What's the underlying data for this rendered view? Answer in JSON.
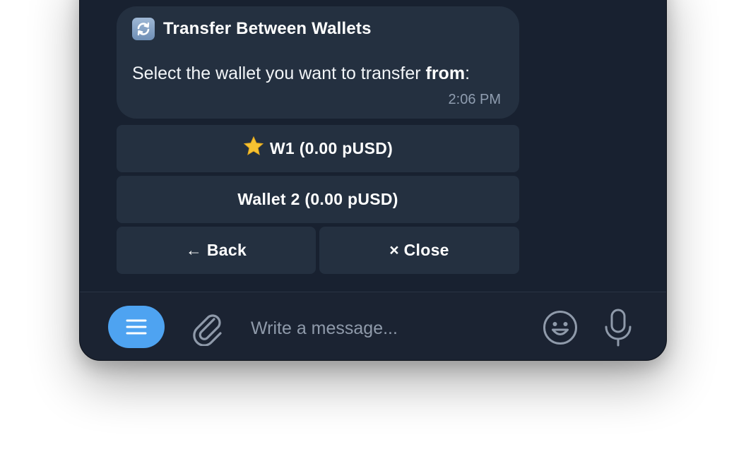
{
  "message": {
    "title": "Transfer Between Wallets",
    "title_icon": "refresh-icon",
    "text_prefix": "Select the wallet you want to transfer ",
    "text_bold": "from",
    "text_suffix": ":",
    "time": "2:06 PM"
  },
  "keyboard": {
    "wallet1_label": "W1 (0.00 pUSD)",
    "wallet1_icon": "star-icon",
    "wallet2_label": "Wallet 2 (0.00 pUSD)",
    "back_label": "← Back",
    "close_label": "× Close"
  },
  "composer": {
    "placeholder": "Write a message...",
    "menu_icon": "menu-icon",
    "attach_icon": "paperclip-icon",
    "emoji_icon": "smiley-icon",
    "mic_icon": "microphone-icon"
  },
  "colors": {
    "accent": "#4ea3f1",
    "background": "#182130",
    "bubble": "#243040",
    "time_text": "#8f9db0"
  }
}
